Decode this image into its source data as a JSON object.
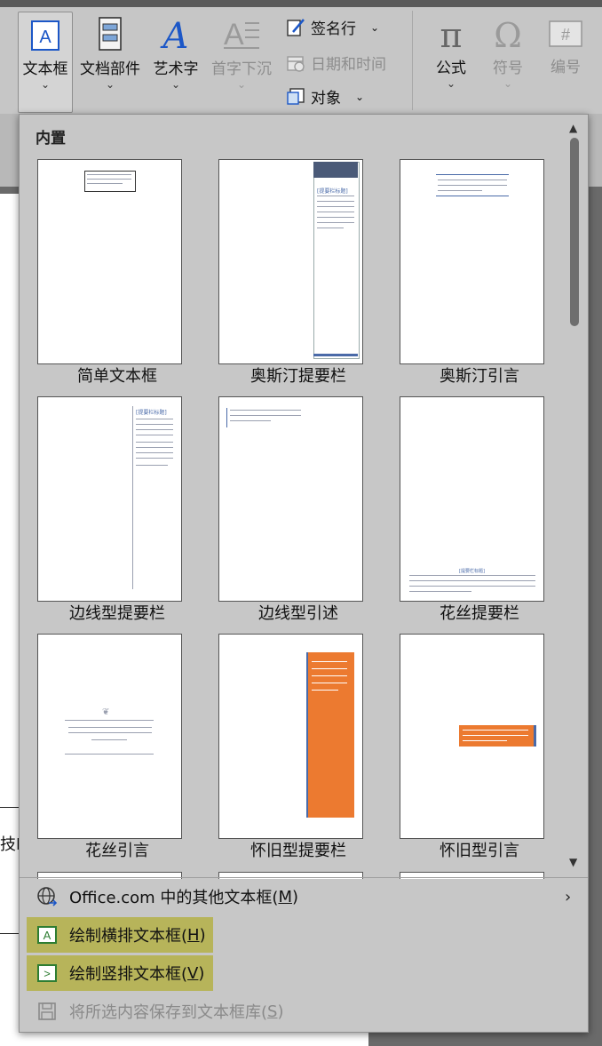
{
  "ribbon": {
    "textbox": "文本框",
    "doc_parts": "文档部件",
    "wordart": "艺术字",
    "drop_cap": "首字下沉",
    "signature_line": "签名行",
    "date_time": "日期和时间",
    "object": "对象",
    "equation": "公式",
    "symbol": "符号",
    "number": "编号"
  },
  "panel": {
    "section_title": "内置",
    "tiles": [
      {
        "name": "简单文本框"
      },
      {
        "name": "奥斯汀提要栏"
      },
      {
        "name": "奥斯汀引言"
      },
      {
        "name": "边线型提要栏"
      },
      {
        "name": "边线型引述"
      },
      {
        "name": "花丝提要栏"
      },
      {
        "name": "花丝引言"
      },
      {
        "name": "怀旧型提要栏"
      },
      {
        "name": "怀旧型引言"
      }
    ],
    "thumb_text": {
      "sidebar_title": "[提要栏标题]",
      "filigree_title": "[提要栏标题]"
    },
    "menu": {
      "more_online_prefix": "Office.com 中的其他文本框(",
      "more_online_key": "M",
      "draw_horizontal_prefix": "绘制横排文本框(",
      "draw_horizontal_key": "H",
      "draw_vertical_prefix": "绘制竖排文本框(",
      "draw_vertical_key": "V",
      "save_selection_prefix": "将所选内容保存到文本框库(",
      "save_selection_key": "S",
      "close_paren": ")"
    }
  },
  "document": {
    "visible_text": "技I"
  },
  "colors": {
    "ribbon_bg": "#c6c6c6",
    "panel_bg": "#c7c7c7",
    "highlight": "#b7b45a",
    "accent_blue": "#1c57c7",
    "retro_orange": "#ec7a30",
    "austin_header": "#4a5a78"
  }
}
